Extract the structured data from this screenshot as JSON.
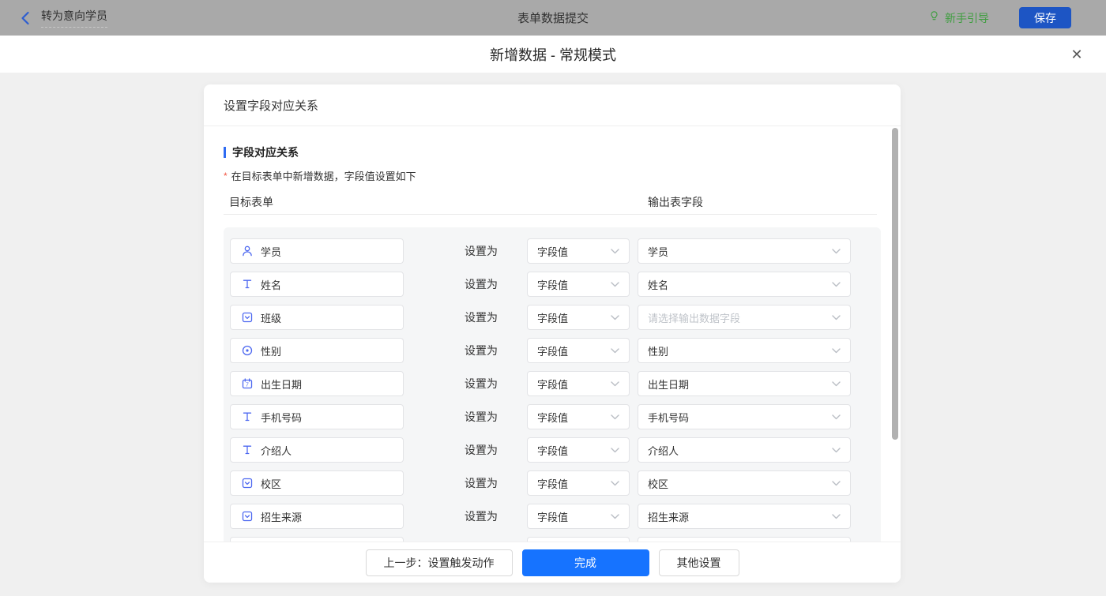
{
  "topbar": {
    "back_label": "转为意向学员",
    "title": "表单数据提交",
    "guide_label": "新手引导",
    "save_label": "保存"
  },
  "modal": {
    "title": "新增数据 - 常规模式",
    "close_icon": "✕"
  },
  "card": {
    "header": "设置字段对应关系",
    "section_title": "字段对应关系",
    "required_mark": "*",
    "section_note": "在目标表单中新增数据，字段值设置如下",
    "col_left": "目标表单",
    "col_right": "输出表字段",
    "set_as_label": "设置为",
    "rows": [
      {
        "icon": "user-icon",
        "field": "学员",
        "mode": "字段值",
        "output": "学员",
        "output_placeholder": false
      },
      {
        "icon": "text-icon",
        "field": "姓名",
        "mode": "字段值",
        "output": "姓名",
        "output_placeholder": false
      },
      {
        "icon": "select-icon",
        "field": "班级",
        "mode": "字段值",
        "output": "请选择输出数据字段",
        "output_placeholder": true
      },
      {
        "icon": "radio-icon",
        "field": "性别",
        "mode": "字段值",
        "output": "性别",
        "output_placeholder": false
      },
      {
        "icon": "calendar-icon",
        "field": "出生日期",
        "mode": "字段值",
        "output": "出生日期",
        "output_placeholder": false
      },
      {
        "icon": "text-icon",
        "field": "手机号码",
        "mode": "字段值",
        "output": "手机号码",
        "output_placeholder": false
      },
      {
        "icon": "text-icon",
        "field": "介绍人",
        "mode": "字段值",
        "output": "介绍人",
        "output_placeholder": false
      },
      {
        "icon": "select-icon",
        "field": "校区",
        "mode": "字段值",
        "output": "校区",
        "output_placeholder": false
      },
      {
        "icon": "select-icon",
        "field": "招生来源",
        "mode": "字段值",
        "output": "招生来源",
        "output_placeholder": false
      }
    ],
    "partial_row_visible": true
  },
  "footer": {
    "prev_label": "上一步：设置触发动作",
    "done_label": "完成",
    "other_label": "其他设置"
  },
  "icons": {
    "back": "chevron-left-icon",
    "guide": "lightbulb-icon",
    "close": "x-icon",
    "dropdown": "chevron-down-icon"
  },
  "colors": {
    "topbar_bg": "#a9a9a9",
    "save_button": "#1d55c4",
    "primary_button": "#1673ff",
    "guide_green": "#3f9e40",
    "field_icon_blue": "#4d68f0",
    "section_bar_blue": "#2e6bf2",
    "required_red": "#f25643",
    "panel_bg": "#f5f6f7",
    "page_bg": "#f0f0f0"
  }
}
